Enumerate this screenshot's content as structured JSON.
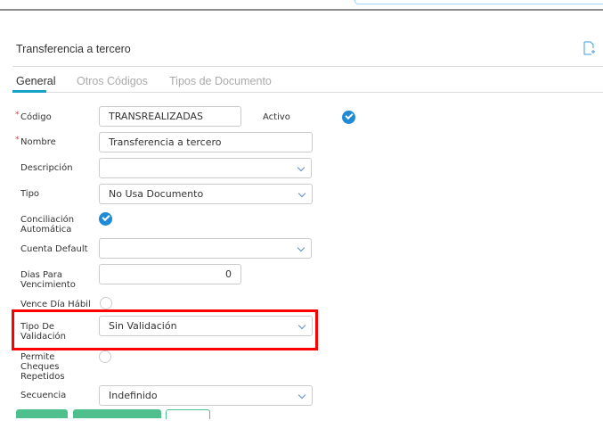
{
  "header": {
    "title": "Transferencia a tercero"
  },
  "tabs": [
    {
      "label": "General"
    },
    {
      "label": "Otros Códigos"
    },
    {
      "label": "Tipos de Documento"
    }
  ],
  "form": {
    "codigo": {
      "label": "Código",
      "value": "TRANSREALIZADAS"
    },
    "activo": {
      "label": "Activo",
      "checked": true
    },
    "nombre": {
      "label": "Nombre",
      "value": "Transferencia a tercero"
    },
    "descripcion": {
      "label": "Descripción",
      "value": ""
    },
    "tipo": {
      "label": "Tipo",
      "value": "No Usa Documento"
    },
    "conciliacion": {
      "label": "Conciliación Automática",
      "checked": true
    },
    "cuenta_default": {
      "label": "Cuenta Default",
      "value": ""
    },
    "dias_vencimiento": {
      "label": "Dias Para Vencimiento",
      "value": "0"
    },
    "vence_dia_habil": {
      "label": "Vence Día Hábil",
      "checked": false
    },
    "tipo_validacion": {
      "label": "Tipo De Validación",
      "value": "Sin Validación"
    },
    "permite_cheques": {
      "label": "Permite Cheques Repetidos",
      "checked": false
    },
    "secuencia": {
      "label": "Secuencia",
      "value": "Indefinido"
    }
  },
  "colors": {
    "accent": "#17a2c8",
    "check": "#1f8ad6",
    "highlight": "#ff0000",
    "button": "#4fc08d"
  }
}
